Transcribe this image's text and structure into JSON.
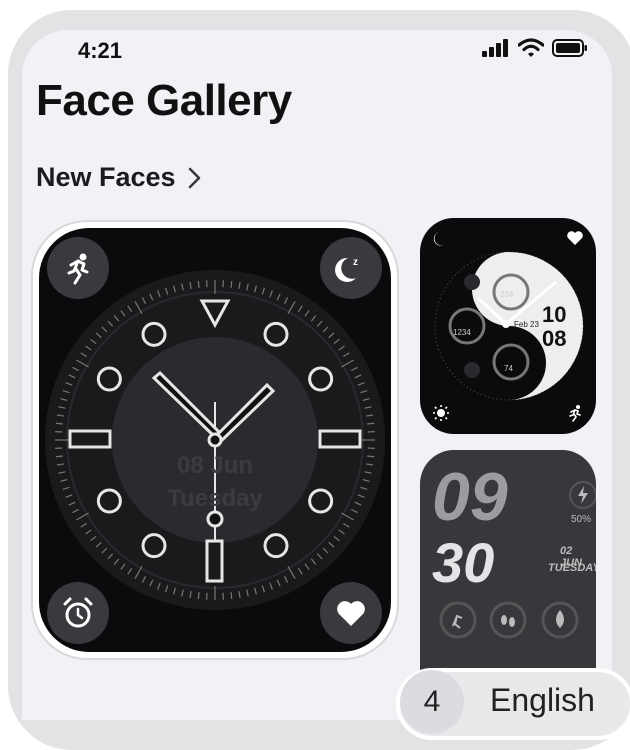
{
  "status_bar": {
    "time": "4:21"
  },
  "page": {
    "title": "Face Gallery"
  },
  "section": {
    "label": "New Faces"
  },
  "faces": {
    "big": {
      "date": "08 Jun",
      "day": "Tuesday"
    },
    "small1": {
      "steps": "234",
      "heart": "1234",
      "battery": "74",
      "date": "Feb 23",
      "hour": "10",
      "minute": "08"
    },
    "small2": {
      "hour": "09",
      "minute": "30",
      "battery": "50%",
      "date": "02 JUN",
      "day": "TUESDAY"
    }
  },
  "language": {
    "count": "4",
    "label": "English"
  }
}
